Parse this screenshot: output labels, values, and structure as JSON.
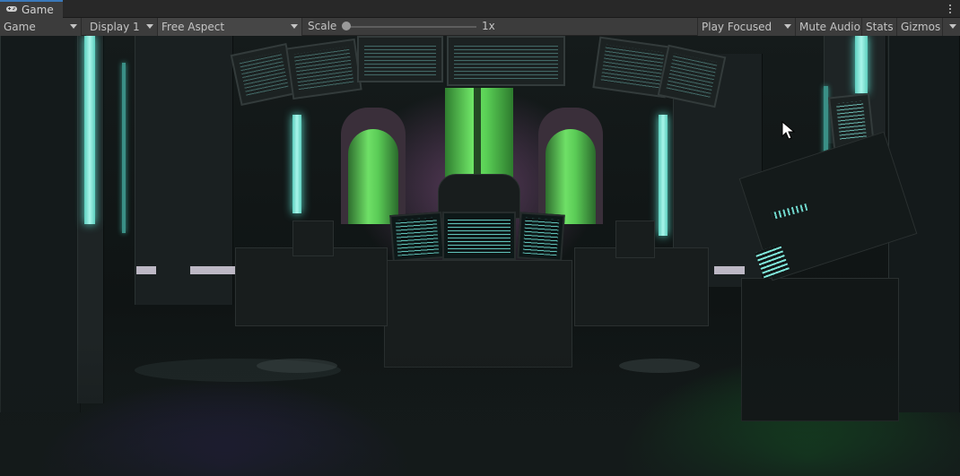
{
  "tab": {
    "icon": "gamepad-icon",
    "label": "Game"
  },
  "toolbar": {
    "view_dropdown": "Game",
    "display_dropdown": "Display 1",
    "aspect_dropdown": "Free Aspect",
    "scale_label": "Scale",
    "scale_value": "1x",
    "scale_level": 0,
    "play_mode_dropdown": "Play Focused",
    "mute_audio": "Mute Audio",
    "stats": "Stats",
    "gizmos": "Gizmos"
  },
  "colors": {
    "accent": "#3a79bb",
    "neon_cyan": "#7ee8da",
    "tank_green": "#62d45c",
    "glow_purple": "#9a5a9a",
    "floor_green": "#1fa03a",
    "floor_purple": "#46289a"
  }
}
